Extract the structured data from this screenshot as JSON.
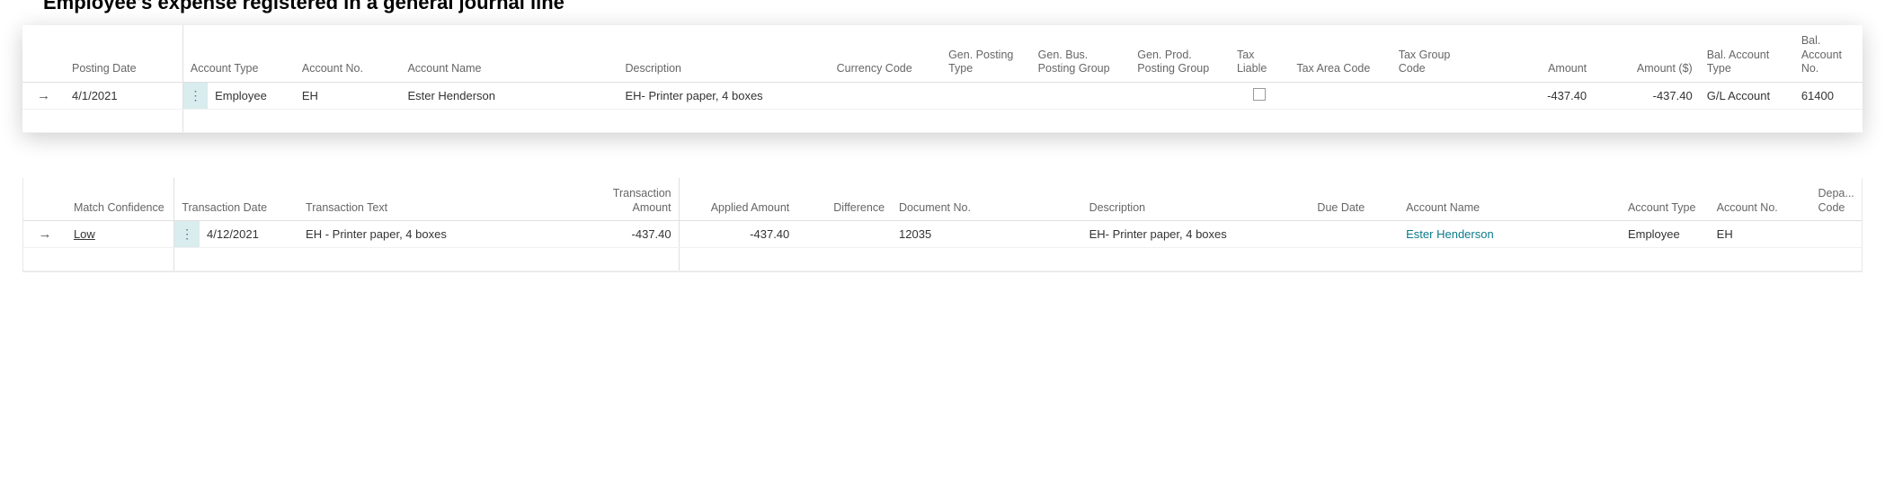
{
  "title_fragment": "Employee's expense registered in a general journal line",
  "journal": {
    "headers": {
      "posting_date": "Posting Date",
      "account_type": "Account Type",
      "account_no": "Account No.",
      "account_name": "Account Name",
      "description": "Description",
      "currency_code": "Currency Code",
      "gen_posting_type": "Gen. Posting Type",
      "gen_bus_posting_group": "Gen. Bus. Posting Group",
      "gen_prod_posting_group": "Gen. Prod. Posting Group",
      "tax_liable": "Tax Liable",
      "tax_area_code": "Tax Area Code",
      "tax_group_code": "Tax Group Code",
      "amount": "Amount",
      "amount_local": "Amount ($)",
      "bal_account_type": "Bal. Account Type",
      "bal_account_no": "Bal. Account No."
    },
    "row": {
      "posting_date": "4/1/2021",
      "account_type": "Employee",
      "account_no": "EH",
      "account_name": "Ester Henderson",
      "description": "EH- Printer paper, 4 boxes",
      "currency_code": "",
      "gen_posting_type": "",
      "gen_bus_posting_group": "",
      "gen_prod_posting_group": "",
      "tax_liable": false,
      "tax_area_code": "",
      "tax_group_code": "",
      "amount": "-437.40",
      "amount_local": "-437.40",
      "bal_account_type": "G/L Account",
      "bal_account_no": "61400"
    }
  },
  "recon": {
    "headers": {
      "match_confidence": "Match Confidence",
      "transaction_date": "Transaction Date",
      "transaction_text": "Transaction Text",
      "transaction_amount": "Transaction Amount",
      "applied_amount": "Applied Amount",
      "difference": "Difference",
      "document_no": "Document No.",
      "description": "Description",
      "due_date": "Due Date",
      "account_name": "Account Name",
      "account_type": "Account Type",
      "account_no": "Account No.",
      "depa_code": "Depa... Code"
    },
    "row": {
      "match_confidence": "Low",
      "transaction_date": "4/12/2021",
      "transaction_text": "EH - Printer paper, 4 boxes",
      "transaction_amount": "-437.40",
      "applied_amount": "-437.40",
      "difference": "",
      "document_no": "12035",
      "description": "EH- Printer paper, 4 boxes",
      "due_date": "",
      "account_name": "Ester Henderson",
      "account_type": "Employee",
      "account_no": "EH",
      "depa_code": ""
    }
  }
}
